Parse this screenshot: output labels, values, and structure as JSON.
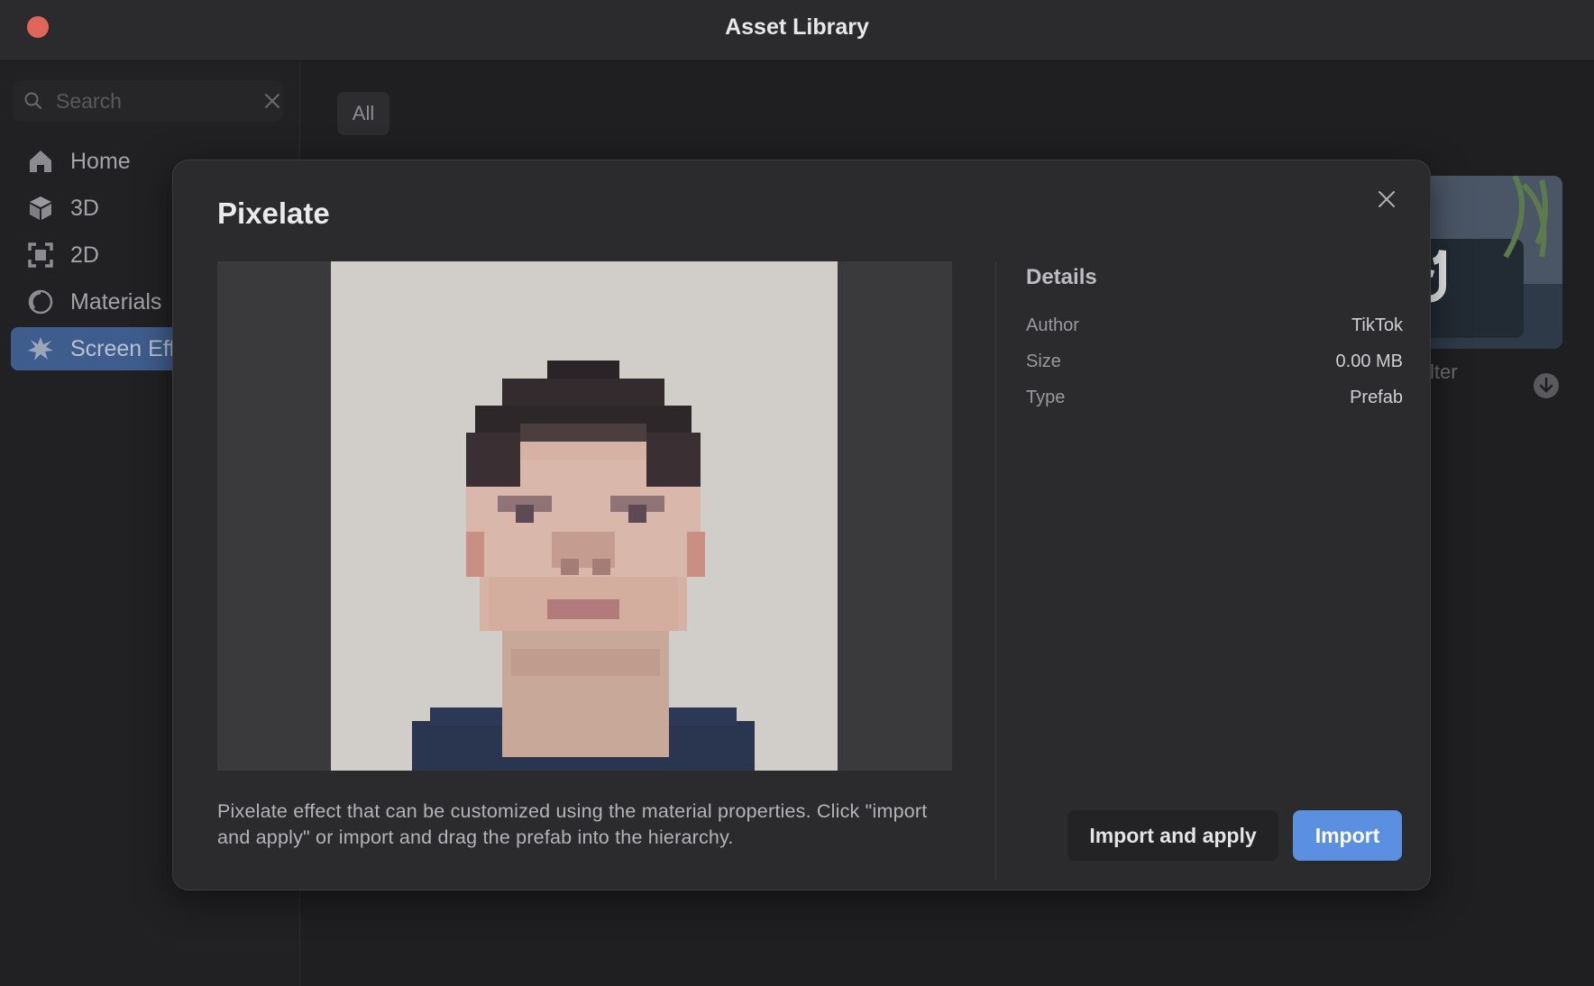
{
  "window": {
    "title": "Asset Library"
  },
  "sidebar": {
    "search_placeholder": "Search",
    "items": [
      {
        "label": "Home",
        "icon": "home-icon",
        "active": false
      },
      {
        "label": "3D",
        "icon": "cube-icon",
        "active": false
      },
      {
        "label": "2D",
        "icon": "frame-2d-icon",
        "active": false
      },
      {
        "label": "Materials",
        "icon": "materials-icon",
        "active": false
      },
      {
        "label": "Screen Effe",
        "icon": "screen-effects-icon",
        "active": true
      }
    ]
  },
  "main": {
    "filter_chip": "All",
    "background_card_label": "lter"
  },
  "modal": {
    "title": "Pixelate",
    "description": "Pixelate effect that can be customized using the material properties. Click \"import and apply\" or import and drag the prefab into the hierarchy.",
    "details": {
      "title": "Details",
      "rows": [
        {
          "key": "Author",
          "value": "TikTok"
        },
        {
          "key": "Size",
          "value": "0.00 MB"
        },
        {
          "key": "Type",
          "value": "Prefab"
        }
      ]
    },
    "buttons": {
      "import_and_apply": "Import and apply",
      "import": "Import"
    }
  },
  "colors": {
    "accent": "#5b8fe0",
    "active_nav": "#3f5d8c",
    "close_dot": "#e0655a"
  }
}
